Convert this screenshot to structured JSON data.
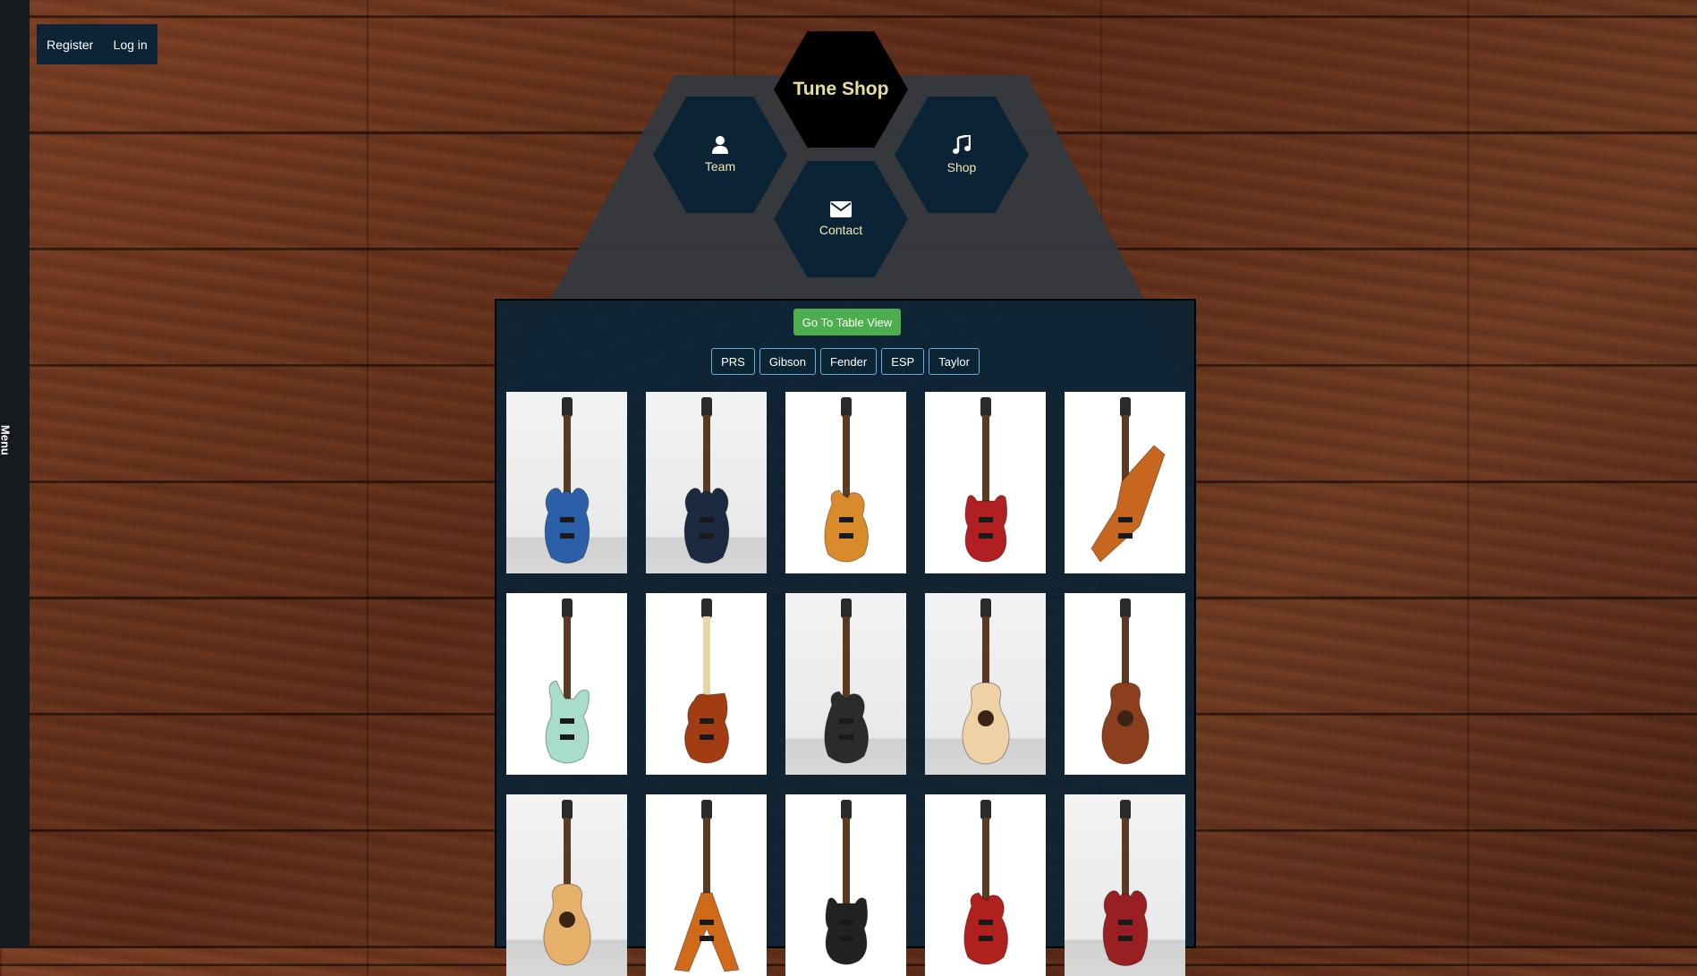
{
  "side_menu": {
    "label": "Menu"
  },
  "auth": {
    "register": "Register",
    "login": "Log in"
  },
  "nav": {
    "brand": "Tune Shop",
    "team": "Team",
    "shop": "Shop",
    "contact": "Contact"
  },
  "actions": {
    "table_view": "Go To Table View"
  },
  "filters": [
    "PRS",
    "Gibson",
    "Fender",
    "ESP",
    "Taylor"
  ],
  "products": [
    {
      "shape": "prs",
      "color": "#2b5fa8",
      "bg": "brick"
    },
    {
      "shape": "prs",
      "color": "#1c2940",
      "bg": "brick"
    },
    {
      "shape": "lespaul",
      "color": "#d98a2b",
      "bg": "white"
    },
    {
      "shape": "sg",
      "color": "#b01f22",
      "bg": "white"
    },
    {
      "shape": "explorer",
      "color": "#c7661f",
      "bg": "white"
    },
    {
      "shape": "strat",
      "color": "#a8dccb",
      "bg": "white"
    },
    {
      "shape": "tele",
      "color": "#a23c12",
      "bg": "white"
    },
    {
      "shape": "lespaul",
      "color": "#2b2b2b",
      "bg": "brick"
    },
    {
      "shape": "acoustic",
      "color": "#efd1a6",
      "bg": "brick"
    },
    {
      "shape": "acoustic",
      "color": "#8b3f1c",
      "bg": "white"
    },
    {
      "shape": "acoustic",
      "color": "#e5b06a",
      "bg": "brick"
    },
    {
      "shape": "flyingv",
      "color": "#cf6a1b",
      "bg": "white"
    },
    {
      "shape": "sg",
      "color": "#222222",
      "bg": "white"
    },
    {
      "shape": "lespaul",
      "color": "#b0201d",
      "bg": "white"
    },
    {
      "shape": "prs",
      "color": "#9a1f23",
      "bg": "brick"
    }
  ]
}
